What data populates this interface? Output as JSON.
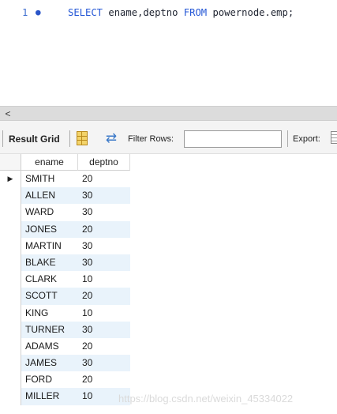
{
  "editor": {
    "line_number": "1",
    "line_marker": "●",
    "kw_select": "SELECT",
    "columns": " ename,deptno ",
    "kw_from": "FROM",
    "table": " powernode.emp;"
  },
  "scrollbar": {
    "left_arrow": "<"
  },
  "toolbar": {
    "result_grid": "Result Grid",
    "filter_rows": "Filter Rows:",
    "filter_value": "",
    "export": "Export:"
  },
  "grid": {
    "headers": {
      "ename": "ename",
      "deptno": "deptno"
    },
    "current_row_marker": "▶",
    "rows": [
      {
        "ename": "SMITH",
        "deptno": "20"
      },
      {
        "ename": "ALLEN",
        "deptno": "30"
      },
      {
        "ename": "WARD",
        "deptno": "30"
      },
      {
        "ename": "JONES",
        "deptno": "20"
      },
      {
        "ename": "MARTIN",
        "deptno": "30"
      },
      {
        "ename": "BLAKE",
        "deptno": "30"
      },
      {
        "ename": "CLARK",
        "deptno": "10"
      },
      {
        "ename": "SCOTT",
        "deptno": "20"
      },
      {
        "ename": "KING",
        "deptno": "10"
      },
      {
        "ename": "TURNER",
        "deptno": "30"
      },
      {
        "ename": "ADAMS",
        "deptno": "20"
      },
      {
        "ename": "JAMES",
        "deptno": "30"
      },
      {
        "ename": "FORD",
        "deptno": "20"
      },
      {
        "ename": "MILLER",
        "deptno": "10"
      }
    ]
  },
  "watermark": "https://blog.csdn.net/weixin_45334022",
  "colors": {
    "keyword": "#2457d6",
    "row_alt": "#e9f3fb"
  },
  "icons": {
    "form": "form-editor-icon",
    "refresh": "refresh-icon",
    "export": "export-icon"
  }
}
